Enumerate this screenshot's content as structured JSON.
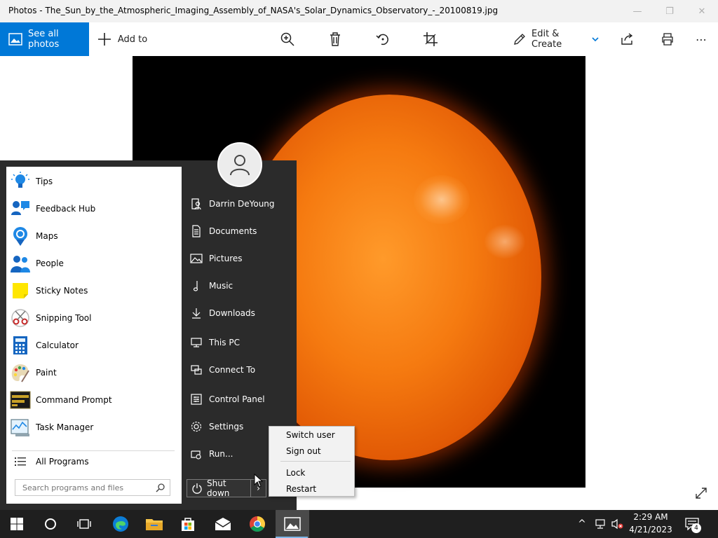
{
  "window": {
    "title": "Photos - The_Sun_by_the_Atmospheric_Imaging_Assembly_of_NASA's_Solar_Dynamics_Observatory_-_20100819.jpg",
    "minimize_glyph": "—",
    "maximize_glyph": "❐",
    "close_glyph": "✕"
  },
  "toolbar": {
    "see_all_label": "See all photos",
    "add_to_label": "Add to",
    "edit_create_label": "Edit & Create",
    "more_glyph": "⋯"
  },
  "start_menu": {
    "apps": [
      {
        "label": "Tips",
        "icon": "lightbulb-icon"
      },
      {
        "label": "Feedback Hub",
        "icon": "feedback-hub-icon"
      },
      {
        "label": "Maps",
        "icon": "maps-icon"
      },
      {
        "label": "People",
        "icon": "people-icon"
      },
      {
        "label": "Sticky Notes",
        "icon": "sticky-notes-icon"
      },
      {
        "label": "Snipping Tool",
        "icon": "snipping-tool-icon"
      },
      {
        "label": "Calculator",
        "icon": "calculator-icon"
      },
      {
        "label": "Paint",
        "icon": "paint-icon"
      },
      {
        "label": "Command Prompt",
        "icon": "command-prompt-icon"
      },
      {
        "label": "Task Manager",
        "icon": "task-manager-icon"
      }
    ],
    "all_programs_label": "All Programs",
    "search_placeholder": "Search programs and files",
    "places": [
      {
        "label": "Darrin DeYoung",
        "icon": "user-folder-icon"
      },
      {
        "label": "Documents",
        "icon": "documents-icon"
      },
      {
        "label": "Pictures",
        "icon": "pictures-icon"
      },
      {
        "label": "Music",
        "icon": "music-icon"
      },
      {
        "label": "Downloads",
        "icon": "downloads-icon"
      },
      {
        "label": "This PC",
        "icon": "this-pc-icon"
      },
      {
        "label": "Connect To",
        "icon": "connect-to-icon"
      },
      {
        "label": "Control Panel",
        "icon": "control-panel-icon"
      },
      {
        "label": "Settings",
        "icon": "settings-gear-icon"
      },
      {
        "label": "Run...",
        "icon": "run-icon"
      }
    ],
    "shutdown_label": "Shut down",
    "shutdown_arrow": "›"
  },
  "power_menu": {
    "items": [
      "Switch user",
      "Sign out",
      "Lock",
      "Restart"
    ]
  },
  "taskbar": {
    "time": "2:29 AM",
    "date": "4/21/2023",
    "notification_count": "4",
    "tray_chevron": "^"
  },
  "colors": {
    "accent": "#0078d7",
    "start_menu_bg": "#2b2b2b",
    "taskbar_bg": "#1f1f1f"
  }
}
